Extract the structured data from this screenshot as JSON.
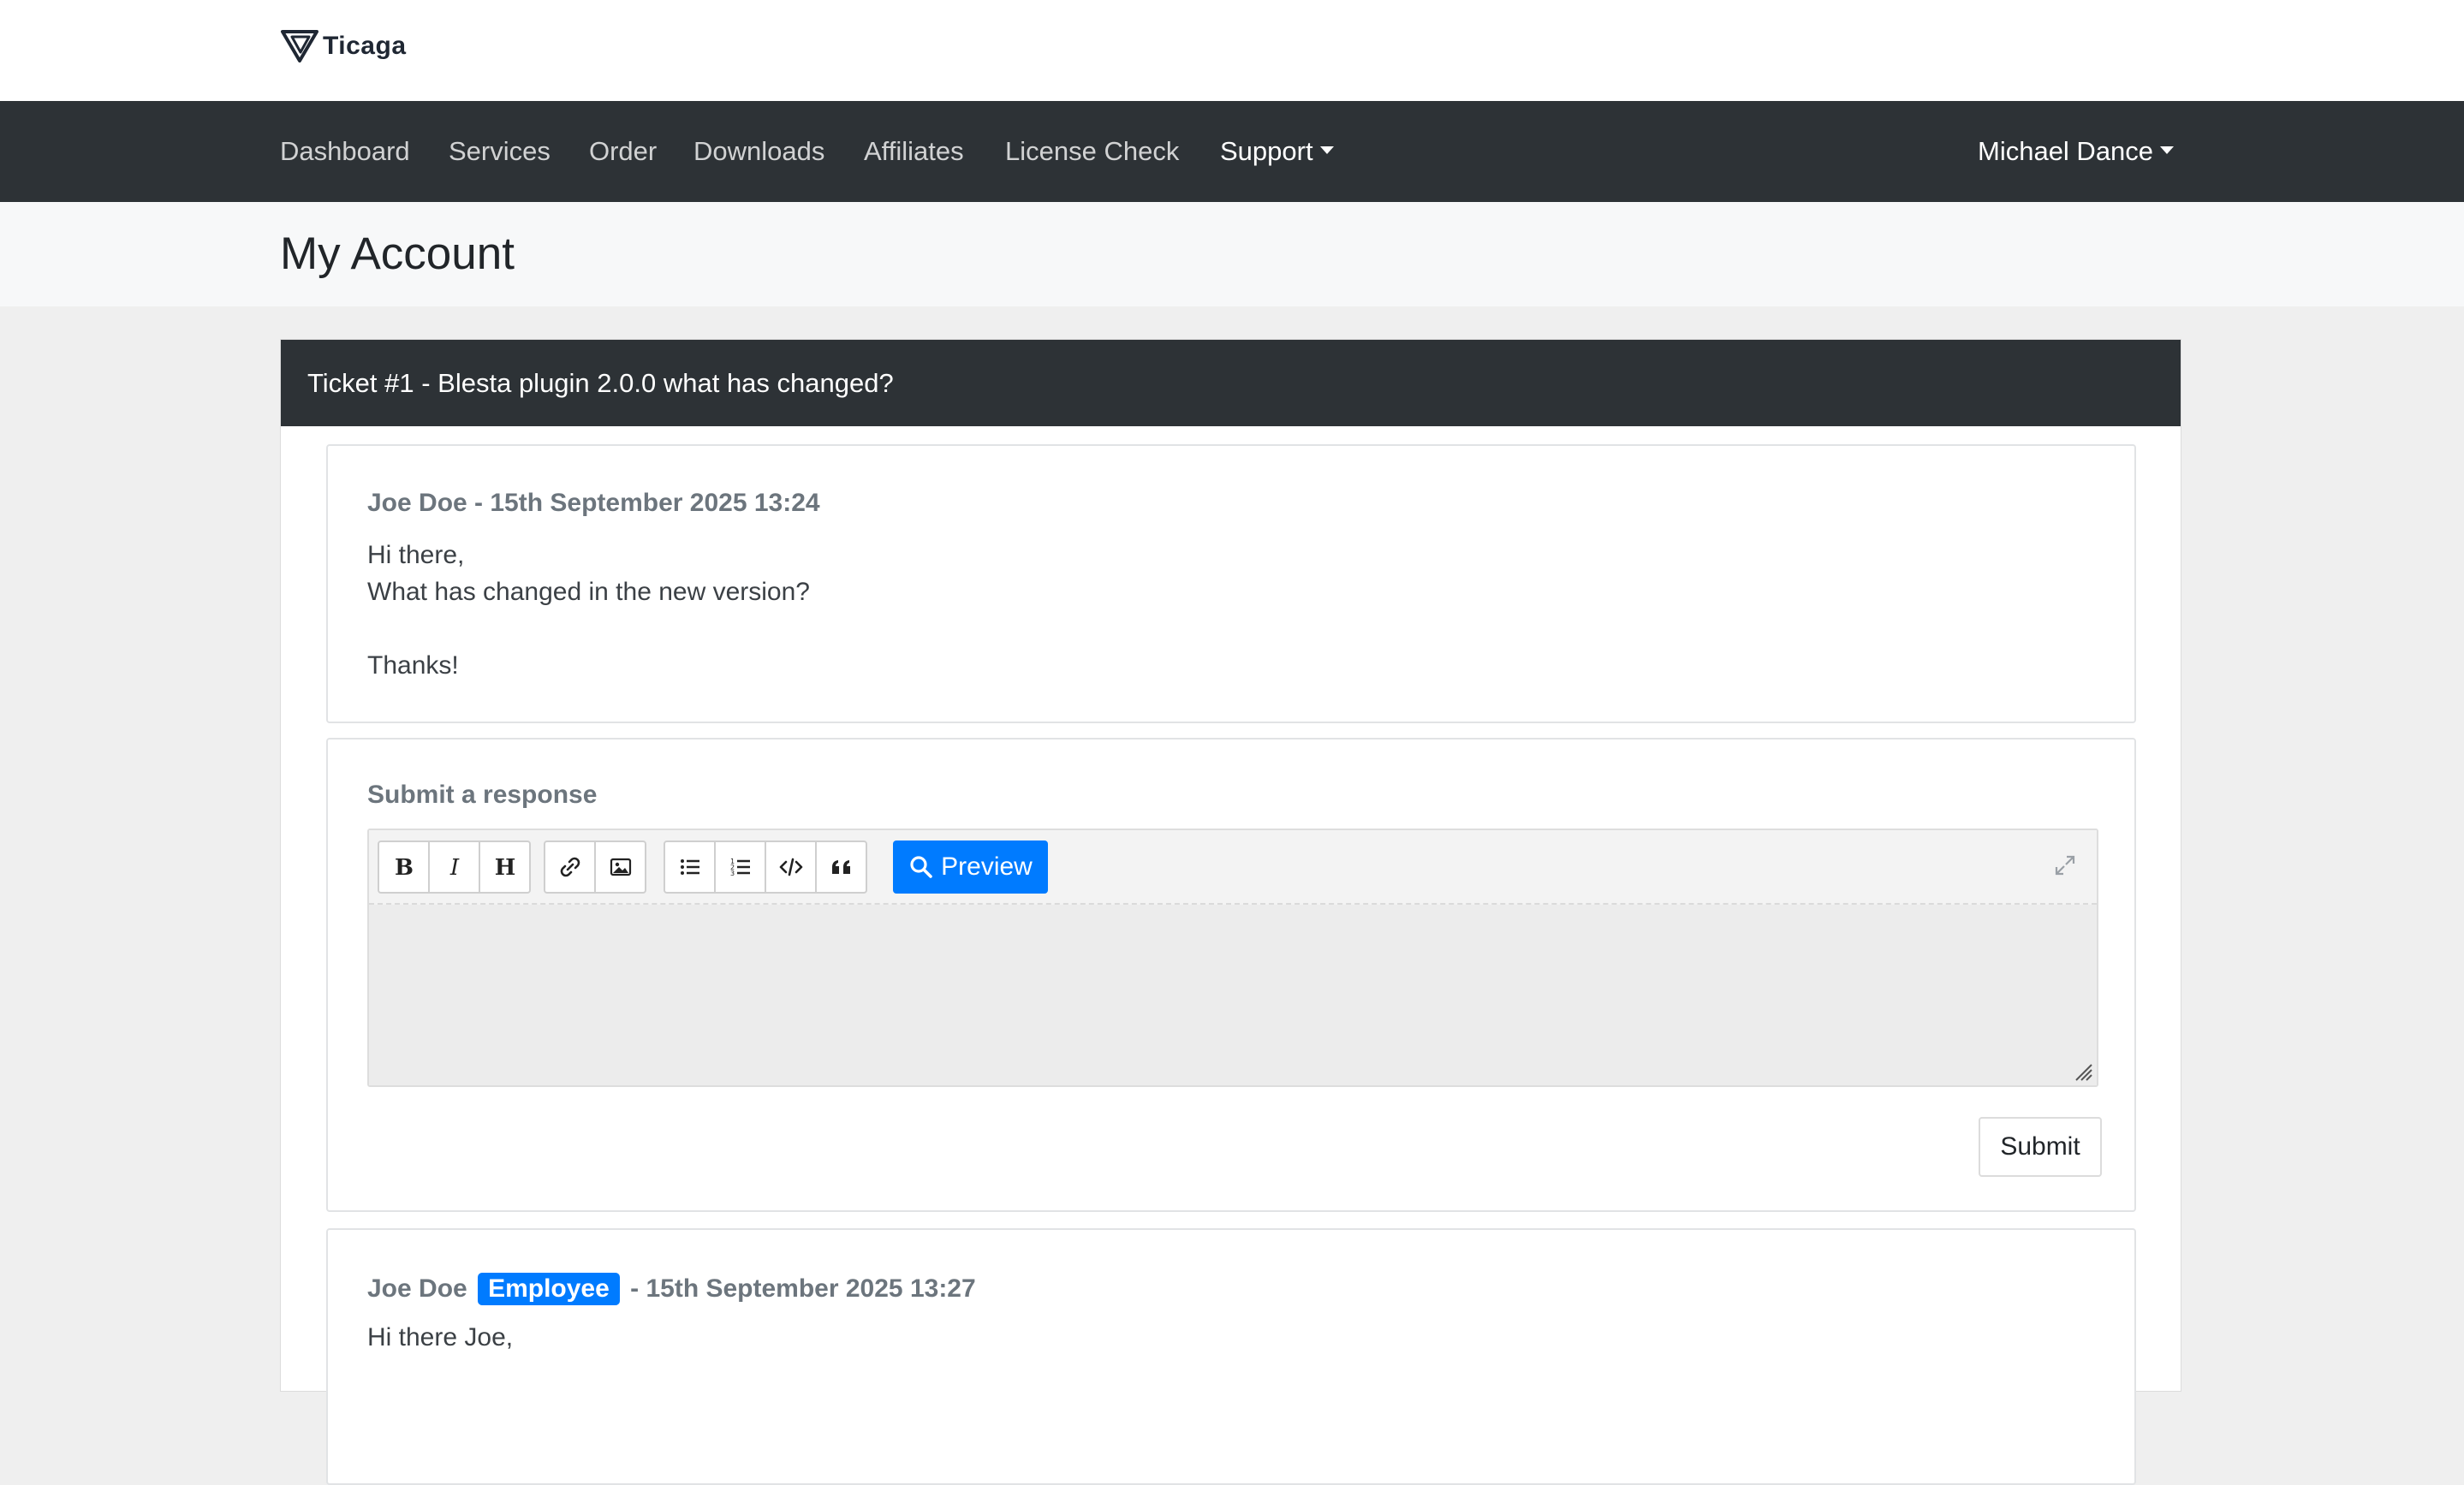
{
  "brand": {
    "name": "Ticaga"
  },
  "nav": {
    "items": [
      "Dashboard",
      "Services",
      "Order",
      "Downloads",
      "Affiliates",
      "License Check"
    ],
    "support": "Support",
    "user": "Michael Dance"
  },
  "page": {
    "title": "My Account"
  },
  "ticket": {
    "header": "Ticket #1 - Blesta plugin 2.0.0 what has changed?"
  },
  "message1": {
    "meta": "Joe Doe - 15th September 2025 13:24",
    "lines": [
      "Hi there,",
      "What has changed in the new version?",
      "",
      "Thanks!"
    ]
  },
  "response": {
    "title": "Submit a response",
    "preview_label": "Preview",
    "submit_label": "Submit",
    "toolbar_icons": [
      "bold-icon",
      "italic-icon",
      "heading-icon",
      "link-icon",
      "image-icon",
      "unordered-list-icon",
      "ordered-list-icon",
      "code-icon",
      "quote-icon"
    ]
  },
  "message2": {
    "author": "Joe Doe",
    "badge": "Employee",
    "date": "- 15th September 2025 13:27",
    "first_line": "Hi there Joe,"
  },
  "colors": {
    "navbar": "#2d3236",
    "accent": "#007bff"
  }
}
